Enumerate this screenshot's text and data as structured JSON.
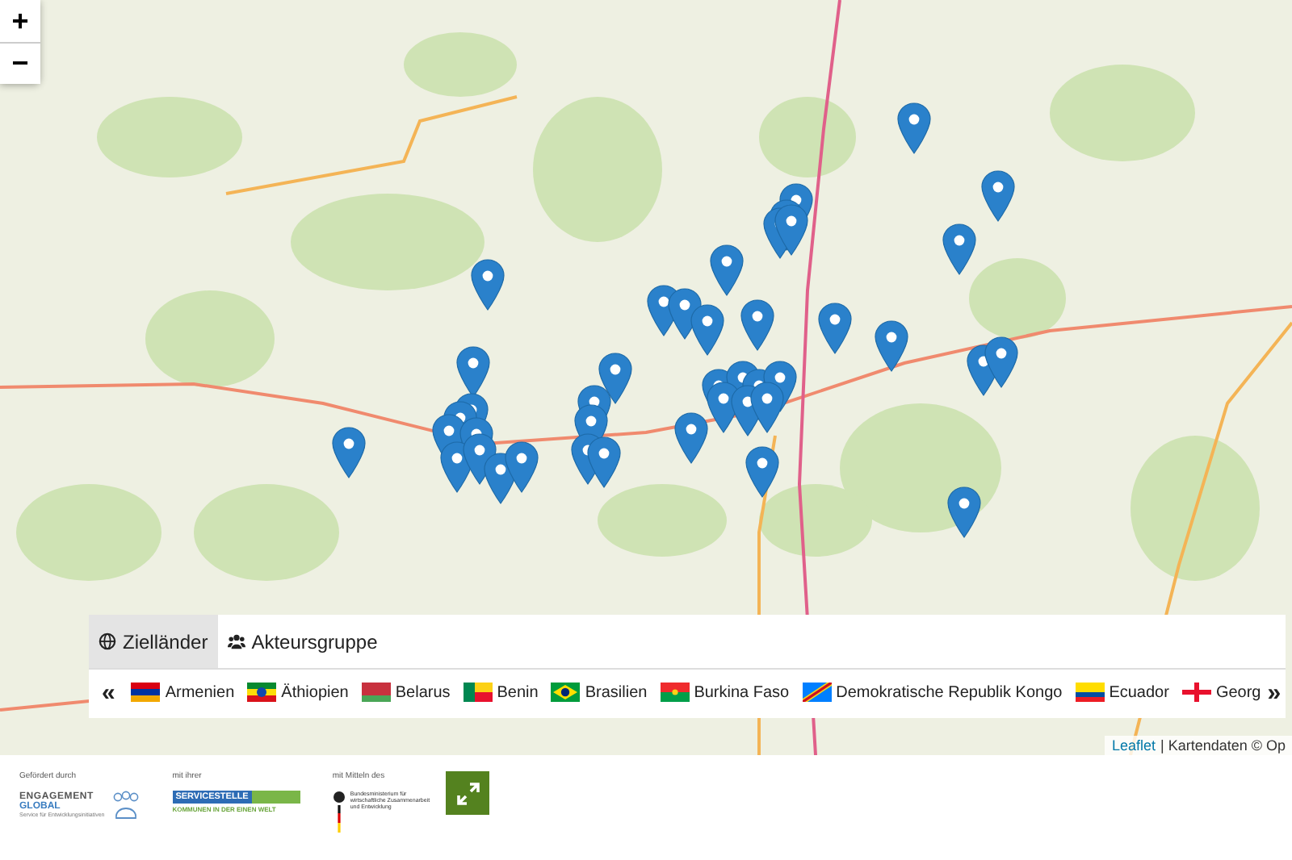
{
  "map": {
    "zoom_in": "+",
    "zoom_out": "−",
    "attribution": {
      "link": "Leaflet",
      "text": "| Kartendaten © Op"
    }
  },
  "panel": {
    "tabs": [
      {
        "label": "Zielländer",
        "selected": true
      },
      {
        "label": "Akteursgruppe",
        "selected": false
      }
    ],
    "prev": "«",
    "next": "»",
    "countries": [
      "Armenien",
      "Äthiopien",
      "Belarus",
      "Benin",
      "Brasilien",
      "Burkina Faso",
      "Demokratische Republik Kongo",
      "Ecuador",
      "Georg"
    ]
  },
  "footer": {
    "logos": [
      {
        "kind": "engagement",
        "caption": "Gefördert durch",
        "lines": [
          "ENGAGEMENT",
          "GLOBAL",
          "Service für Entwicklungsinitiativen"
        ]
      },
      {
        "kind": "servicestelle",
        "caption": "mit ihrer",
        "lines": [
          "SERVICESTELLE",
          "KOMMUNEN IN DER EINEN WELT"
        ]
      },
      {
        "kind": "bmz",
        "caption": "mit Mitteln des",
        "lines": [
          "Bundesministerium für",
          "wirtschaftliche Zusammenarbeit",
          "und Entwicklung"
        ]
      }
    ]
  }
}
